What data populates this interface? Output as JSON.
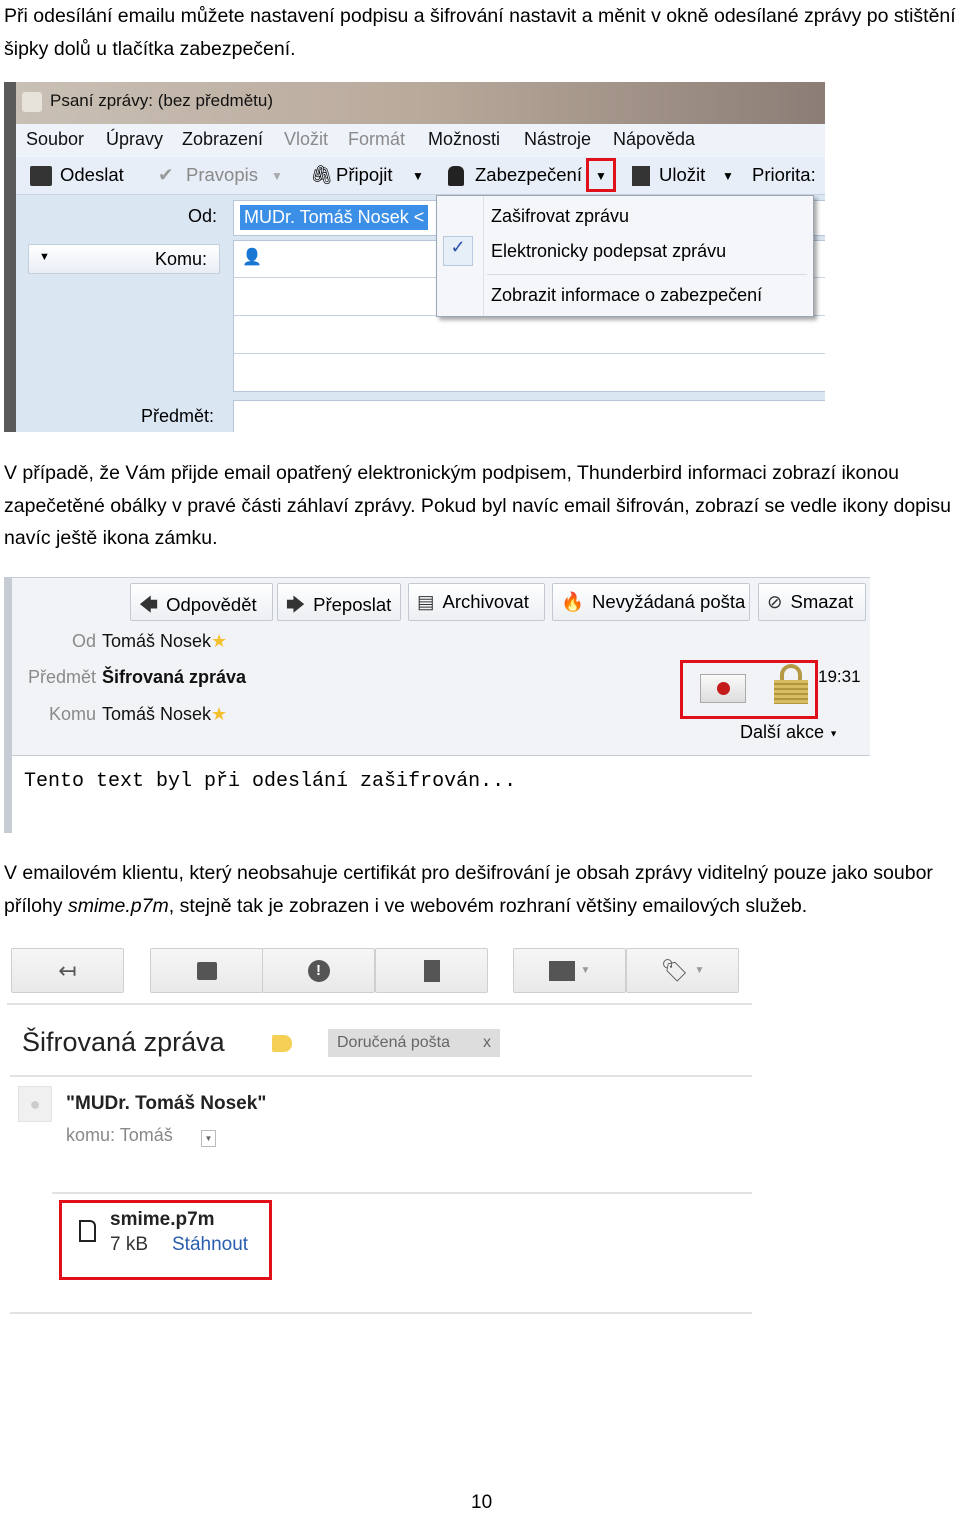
{
  "paragraphs": {
    "p1": "Při odesílání emailu můžete nastavení podpisu a šifrování nastavit a měnit v okně odesílané zprávy po stištění šipky dolů u tlačítka zabezpečení.",
    "p2": "V případě, že Vám přijde email opatřený elektronickým podpisem,  Thunderbird informaci zobrazí ikonou zapečetěné obálky v pravé části záhlaví zprávy. Pokud byl navíc email šifrován, zobrazí se vedle ikony dopisu navíc ještě ikona zámku.",
    "p3_before": "V emailovém klientu, který neobsahuje certifikát pro dešifrování je obsah zprávy viditelný pouze jako soubor přílohy ",
    "p3_italic": "smime.p7m",
    "p3_after": ", stejně tak je zobrazen i ve webovém rozhraní většiny emailových služeb."
  },
  "compose": {
    "title": "Psaní zprávy: (bez předmětu)",
    "menu": [
      "Soubor",
      "Úpravy",
      "Zobrazení",
      "Vložit",
      "Formát",
      "Možnosti",
      "Nástroje",
      "Nápověda"
    ],
    "toolbar": {
      "send": "Odeslat",
      "spell": "Pravopis",
      "attach": "Připojit",
      "security": "Zabezpečení",
      "save": "Uložit",
      "priority": "Priorita:"
    },
    "from_label": "Od:",
    "from_value": "MUDr. Tomáš Nosek <",
    "to_label": "Komu:",
    "subject_label": "Předmět:",
    "security_menu": [
      {
        "label": "Zašifrovat zprávu",
        "checked": false
      },
      {
        "label": "Elektronicky podepsat zprávu",
        "checked": true
      },
      {
        "label": "Zobrazit informace o zabezpečení",
        "checked": false
      }
    ],
    "highlight_color": "#e0101a"
  },
  "reader": {
    "buttons": [
      "Odpovědět",
      "Přeposlat",
      "Archivovat",
      "Nevyžádaná pošta",
      "Smazat"
    ],
    "from_label": "Od",
    "from_value": "Tomáš Nosek",
    "subject_label": "Předmět",
    "subject_value": "Šifrovaná zpráva",
    "to_label": "Komu",
    "to_value": "Tomáš Nosek",
    "time": "19:31",
    "more_actions": "Další akce",
    "body": "Tento text byl při odeslání zašifrován..."
  },
  "webmail": {
    "subject": "Šifrovaná zpráva",
    "label_tag": "Doručená pošta",
    "label_close": "x",
    "sender": "\"MUDr. Tomáš Nosek\"",
    "to": "komu: Tomáš",
    "attachment_name": "smime.p7m",
    "attachment_size": "7 kB",
    "download": "Stáhnout",
    "link_color": "#2a5db0"
  },
  "page_number": "10"
}
